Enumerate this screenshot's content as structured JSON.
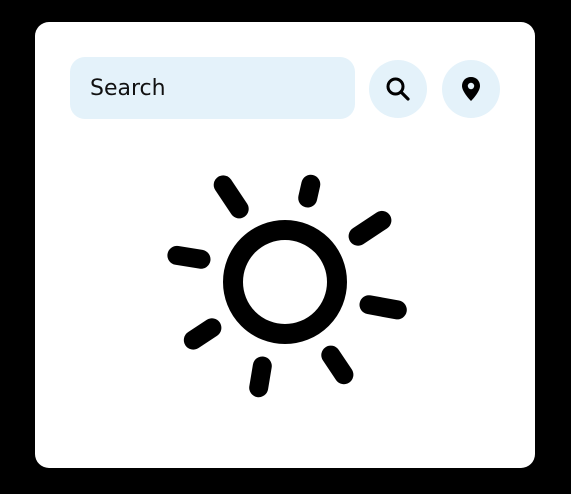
{
  "search": {
    "placeholder": "Search",
    "value": ""
  },
  "buttons": {
    "search_icon": "search-icon",
    "location_icon": "location-pin-icon"
  },
  "weather": {
    "icon": "sun-icon"
  },
  "colors": {
    "background": "#000000",
    "card": "#ffffff",
    "input_bg": "#e4f2fa",
    "icon": "#000000"
  }
}
